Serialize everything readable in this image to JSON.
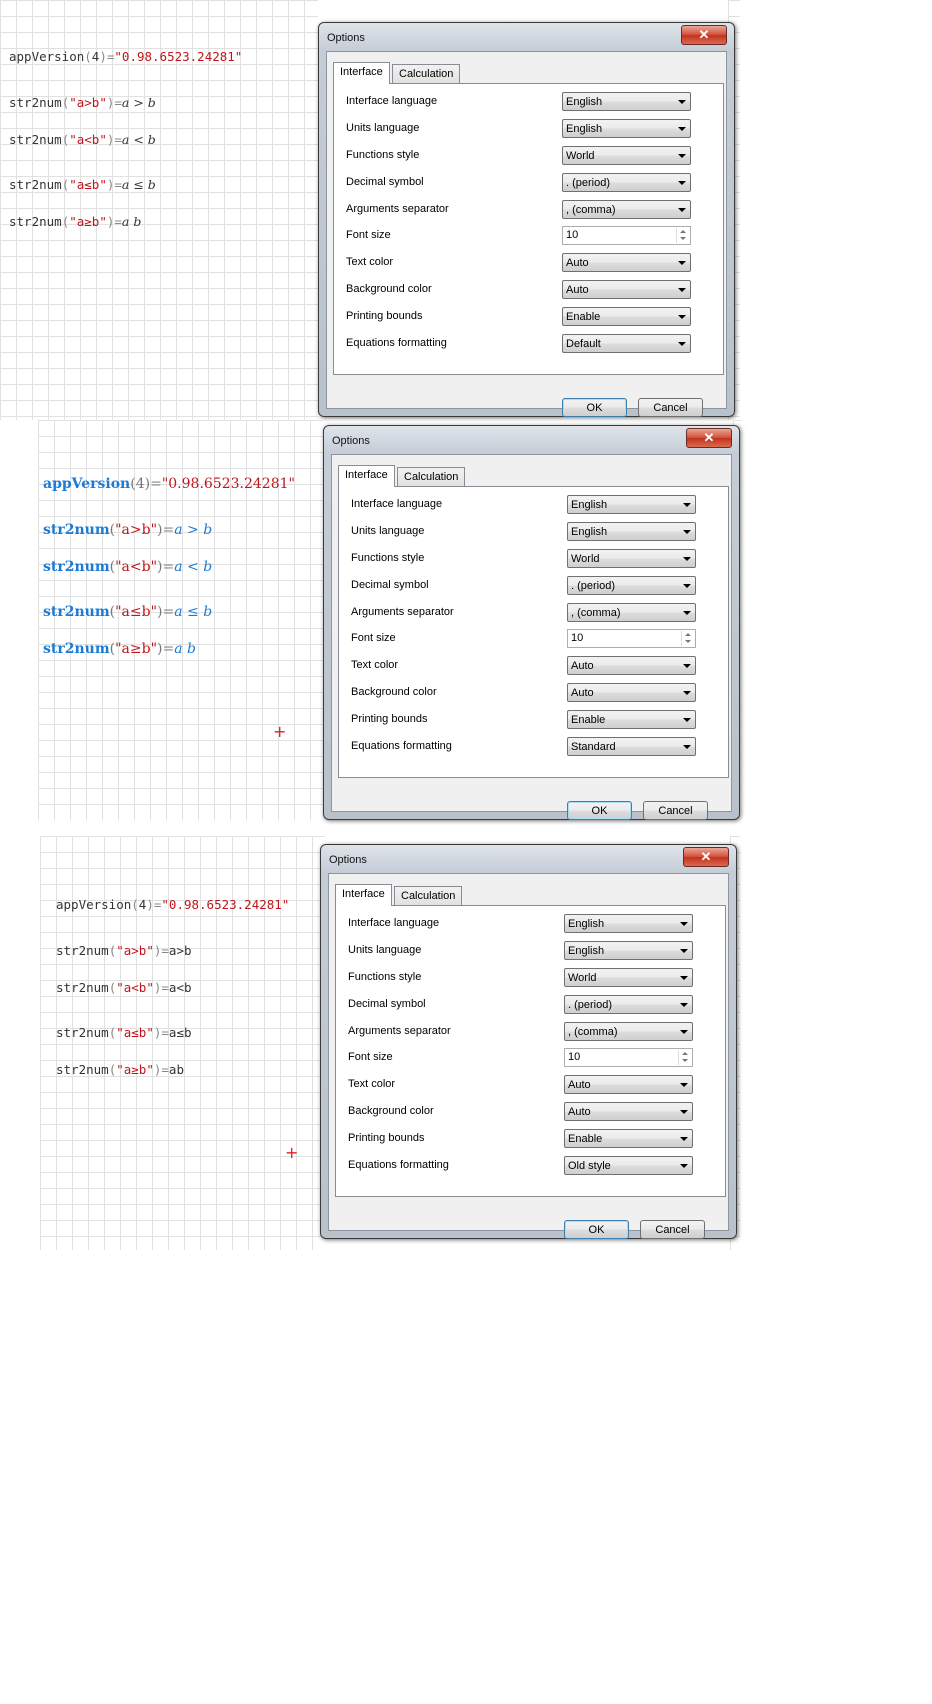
{
  "worksheets": [
    {
      "style": "monospace",
      "lines": [
        {
          "fn": "appVersion",
          "arg": "4",
          "eq": "=",
          "result": "\"0.98.6523.24281\""
        },
        {
          "fn": "str2num",
          "arg": "\"a>b\"",
          "eq": "=",
          "result": "a > b"
        },
        {
          "fn": "str2num",
          "arg": "\"a<b\"",
          "eq": "=",
          "result": "a < b"
        },
        {
          "fn": "str2num",
          "arg": "\"a≤b\"",
          "eq": "=",
          "result": "a ≤ b"
        },
        {
          "fn": "str2num",
          "arg": "\"a≥b\"",
          "eq": "=",
          "result": "a b"
        }
      ]
    },
    {
      "style": "standard",
      "lines": [
        {
          "fn": "appVersion",
          "arg": "4",
          "eq": "=",
          "result": "\"0.98.6523.24281\""
        },
        {
          "fn": "str2num",
          "arg": "\"a>b\"",
          "eq": "=",
          "result": "a > b"
        },
        {
          "fn": "str2num",
          "arg": "\"a<b\"",
          "eq": "=",
          "result": "a < b"
        },
        {
          "fn": "str2num",
          "arg": "\"a≤b\"",
          "eq": "=",
          "result": "a ≤ b"
        },
        {
          "fn": "str2num",
          "arg": "\"a≥b\"",
          "eq": "=",
          "result": "a b"
        }
      ],
      "cursor": "+"
    },
    {
      "style": "old",
      "lines": [
        {
          "fn": "appVersion",
          "arg": "4",
          "eq": "=",
          "result": "\"0.98.6523.24281\""
        },
        {
          "fn": "str2num",
          "arg": "\"a>b\"",
          "eq": "=",
          "result": "a>b"
        },
        {
          "fn": "str2num",
          "arg": "\"a<b\"",
          "eq": "=",
          "result": "a<b"
        },
        {
          "fn": "str2num",
          "arg": "\"a≤b\"",
          "eq": "=",
          "result": "a≤b"
        },
        {
          "fn": "str2num",
          "arg": "\"a≥b\"",
          "eq": "=",
          "result": "ab"
        }
      ],
      "cursor": "+"
    }
  ],
  "dialogs": [
    {
      "title": "Options",
      "close": "✕",
      "tabs": [
        "Interface",
        "Calculation"
      ],
      "rows": [
        {
          "label": "Interface language",
          "value": "English",
          "kind": "combo"
        },
        {
          "label": "Units language",
          "value": "English",
          "kind": "combo"
        },
        {
          "label": "Functions style",
          "value": "World",
          "kind": "combo"
        },
        {
          "label": "Decimal symbol",
          "value": ". (period)",
          "kind": "combo"
        },
        {
          "label": "Arguments separator",
          "value": ", (comma)",
          "kind": "combo"
        },
        {
          "label": "Font size",
          "value": "10",
          "kind": "spin"
        },
        {
          "label": "Text color",
          "value": "Auto",
          "kind": "combo"
        },
        {
          "label": "Background color",
          "value": "Auto",
          "kind": "combo"
        },
        {
          "label": "Printing bounds",
          "value": "Enable",
          "kind": "combo"
        },
        {
          "label": "Equations formatting",
          "value": "Default",
          "kind": "combo"
        }
      ],
      "ok": "OK",
      "cancel": "Cancel"
    },
    {
      "title": "Options",
      "close": "✕",
      "tabs": [
        "Interface",
        "Calculation"
      ],
      "rows": [
        {
          "label": "Interface language",
          "value": "English",
          "kind": "combo"
        },
        {
          "label": "Units language",
          "value": "English",
          "kind": "combo"
        },
        {
          "label": "Functions style",
          "value": "World",
          "kind": "combo"
        },
        {
          "label": "Decimal symbol",
          "value": ". (period)",
          "kind": "combo"
        },
        {
          "label": "Arguments separator",
          "value": ", (comma)",
          "kind": "combo"
        },
        {
          "label": "Font size",
          "value": "10",
          "kind": "spin"
        },
        {
          "label": "Text color",
          "value": "Auto",
          "kind": "combo"
        },
        {
          "label": "Background color",
          "value": "Auto",
          "kind": "combo"
        },
        {
          "label": "Printing bounds",
          "value": "Enable",
          "kind": "combo"
        },
        {
          "label": "Equations formatting",
          "value": "Standard",
          "kind": "combo"
        }
      ],
      "ok": "OK",
      "cancel": "Cancel"
    },
    {
      "title": "Options",
      "close": "✕",
      "tabs": [
        "Interface",
        "Calculation"
      ],
      "rows": [
        {
          "label": "Interface language",
          "value": "English",
          "kind": "combo"
        },
        {
          "label": "Units language",
          "value": "English",
          "kind": "combo"
        },
        {
          "label": "Functions style",
          "value": "World",
          "kind": "combo"
        },
        {
          "label": "Decimal symbol",
          "value": ". (period)",
          "kind": "combo"
        },
        {
          "label": "Arguments separator",
          "value": ", (comma)",
          "kind": "combo"
        },
        {
          "label": "Font size",
          "value": "10",
          "kind": "spin"
        },
        {
          "label": "Text color",
          "value": "Auto",
          "kind": "combo"
        },
        {
          "label": "Background color",
          "value": "Auto",
          "kind": "combo"
        },
        {
          "label": "Printing bounds",
          "value": "Enable",
          "kind": "combo"
        },
        {
          "label": "Equations formatting",
          "value": "Old style",
          "kind": "combo"
        }
      ],
      "ok": "OK",
      "cancel": "Cancel"
    }
  ]
}
